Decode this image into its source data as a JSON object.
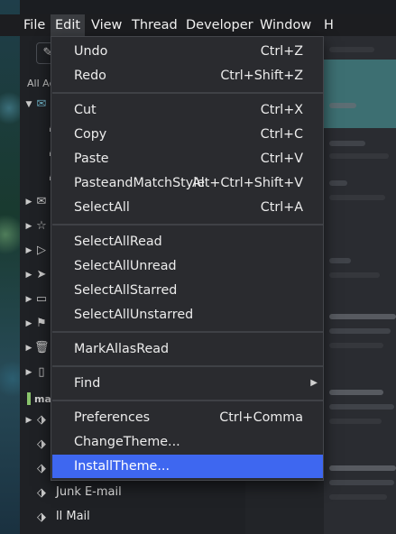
{
  "menubar": {
    "items": [
      {
        "label": "File",
        "active": false
      },
      {
        "label": "Edit",
        "active": true
      },
      {
        "label": "View",
        "active": false
      },
      {
        "label": "Thread",
        "active": false
      },
      {
        "label": "Developer",
        "active": false
      },
      {
        "label": "Window",
        "active": false
      },
      {
        "label": "H",
        "active": false
      }
    ]
  },
  "edit_menu": {
    "groups": [
      [
        {
          "label": "Undo",
          "shortcut": "Ctrl+Z"
        },
        {
          "label": "Redo",
          "shortcut": "Ctrl+Shift+Z"
        }
      ],
      [
        {
          "label": "Cut",
          "shortcut": "Ctrl+X"
        },
        {
          "label": "Copy",
          "shortcut": "Ctrl+C"
        },
        {
          "label": "Paste",
          "shortcut": "Ctrl+V"
        },
        {
          "label": "PasteandMatchStyle",
          "shortcut": "Alt+Ctrl+Shift+V"
        },
        {
          "label": "SelectAll",
          "shortcut": "Ctrl+A"
        }
      ],
      [
        {
          "label": "SelectAllRead",
          "shortcut": ""
        },
        {
          "label": "SelectAllUnread",
          "shortcut": ""
        },
        {
          "label": "SelectAllStarred",
          "shortcut": ""
        },
        {
          "label": "SelectAllUnstarred",
          "shortcut": ""
        }
      ],
      [
        {
          "label": "MarkAllasRead",
          "shortcut": ""
        }
      ],
      [
        {
          "label": "Find",
          "shortcut": "",
          "submenu": true
        }
      ],
      [
        {
          "label": "Preferences",
          "shortcut": "Ctrl+Comma"
        },
        {
          "label": "ChangeTheme...",
          "shortcut": ""
        },
        {
          "label": "InstallTheme...",
          "shortcut": "",
          "highlighted": true
        }
      ]
    ]
  },
  "sidebar": {
    "all_accounts_label": "All Ac",
    "account_label": "mac",
    "folders": [
      {
        "label": "Junk E-mail",
        "icon": "tag-icon"
      },
      {
        "label": "ll Mail",
        "icon": "tag-icon"
      }
    ]
  },
  "colors": {
    "menu_bg": "#2a2b2f",
    "highlight": "#3e67f0",
    "accent_green": "#8ac46c",
    "reading_teal": "#3d6f72"
  }
}
